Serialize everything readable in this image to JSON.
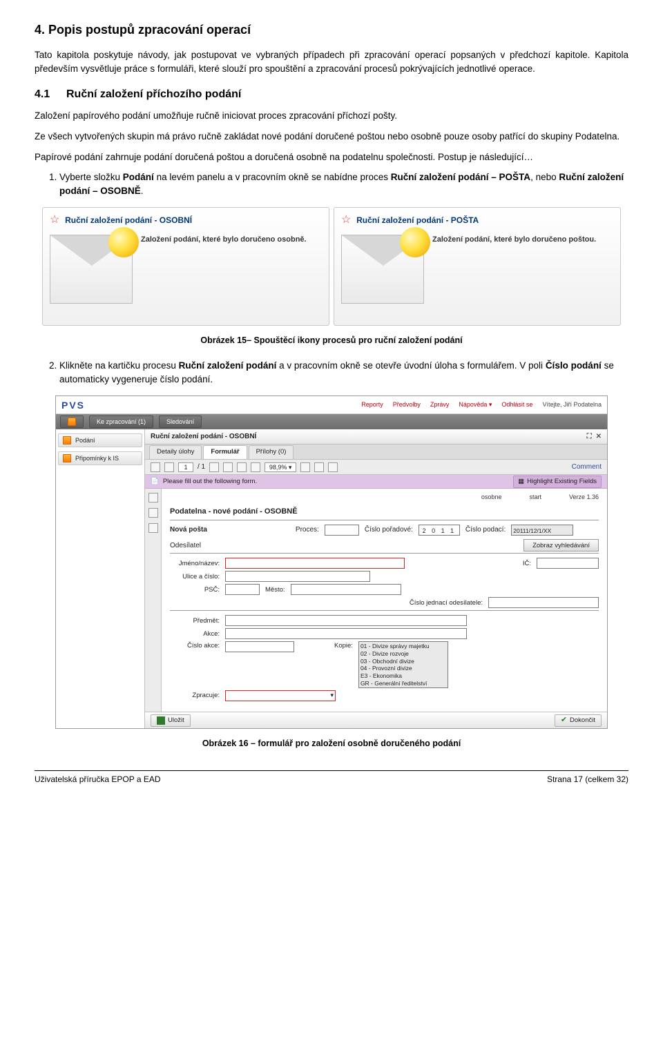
{
  "h2": "4.  Popis postupů zpracování operací",
  "p1": "Tato kapitola poskytuje návody, jak postupovat ve vybraných případech při zpracování operací popsaných v předchozí kapitole. Kapitola především vysvětluje práce s formuláři, které slouží pro spouštění a zpracování procesů pokrývajících jednotlivé operace.",
  "h3num": "4.1",
  "h3": "Ruční založení příchozího podání",
  "p2": "Založení papírového podání umožňuje ručně iniciovat proces zpracování příchozí pošty.",
  "p3": "Ze všech vytvořených skupin má právo ručně zakládat nové podání doručené poštou nebo osobně pouze osoby patřící do skupiny Podatelna.",
  "p4a": "Papírové podání zahrnuje podání doručená poštou a doručená osobně na podatelnu společnosti. Postup je následující…",
  "li1a": "Vyberte složku ",
  "li1b": "Podání",
  "li1c": " na levém panelu a v pracovním okně se nabídne proces ",
  "li1d": "Ruční založení podání – POŠTA",
  "li1e": ", nebo ",
  "li1f": "Ruční založení podání – OSOBNĚ",
  "li1g": ".",
  "card1title": "Ruční založení podání - OSOBNÍ",
  "card1desc": "Založení podání, které bylo doručeno osobně.",
  "card2title": "Ruční založení podání - POŠTA",
  "card2desc": "Založení podání, které bylo doručeno poštou.",
  "cap1": "Obrázek 15– Spouštěcí ikony procesů pro ruční založení podání",
  "li2a": "Klikněte na kartičku procesu ",
  "li2b": "Ruční založení podání",
  "li2c": " a v pracovním okně se otevře úvodní úloha s formulářem. V poli ",
  "li2d": "Číslo podání",
  "li2e": " se automaticky vygeneruje číslo podání.",
  "form": {
    "logo": "PVS",
    "nav": [
      "Reporty",
      "Předvolby",
      "Zprávy",
      "Nápověda ▾",
      "Odhlásit se"
    ],
    "greet": "Vítejte, Jiří Podatelna",
    "tab1": "Ke zpracování (1)",
    "tab2": "Sledování",
    "side1": "Podání",
    "side2": "Připomínky k IS",
    "wintitle": "Ruční založení podání - OSOBNÍ",
    "itab1": "Detaily úlohy",
    "itab2": "Formulář",
    "itab3": "Přílohy (0)",
    "page": "1",
    "pageof": "/ 1",
    "zoom": "98,9% ▾",
    "comment": "Comment",
    "purple": "Please fill out the following form.",
    "highlight": "Highlight Existing Fields",
    "meta1": "osobne",
    "meta2": "start",
    "meta3": "Verze 1.36",
    "doch": "Podatelna - nové podání - OSOBNĚ",
    "l_nova": "Nová pošta",
    "l_proces": "Proces:",
    "l_cporad": "Číslo pořadové:",
    "v_cporad": "2 0 1 1",
    "l_cpod": "Číslo podací:",
    "v_cpod": "20111/12/1/XX",
    "sec_odes": "Odesílatel",
    "btn_vyhl": "Zobraz vyhledávání",
    "l_jmeno": "Jméno/název:",
    "l_ic": "IČ:",
    "l_ulice": "Ulice a číslo:",
    "l_psc": "PSČ:",
    "l_mesto": "Město:",
    "l_cjedn": "Číslo jednací odesílatele:",
    "l_predmet": "Předmět:",
    "l_akce": "Akce:",
    "l_cakce": "Číslo akce:",
    "l_kopie": "Kopie:",
    "l_zprac": "Zpracuje:",
    "kopie": [
      "01 - Divize správy majetku",
      "02 - Divize rozvoje",
      "03 - Obchodní divize",
      "04 - Provozní divize",
      "E3 - Ekonomika",
      "GR - Generální ředitelství"
    ],
    "save": "Uložit",
    "done": "Dokončit"
  },
  "cap2": "Obrázek 16 – formulář pro založení osobně doručeného podání",
  "footL": "Uživatelská příručka EPOP a EAD",
  "footR": "Strana 17 (celkem 32)"
}
